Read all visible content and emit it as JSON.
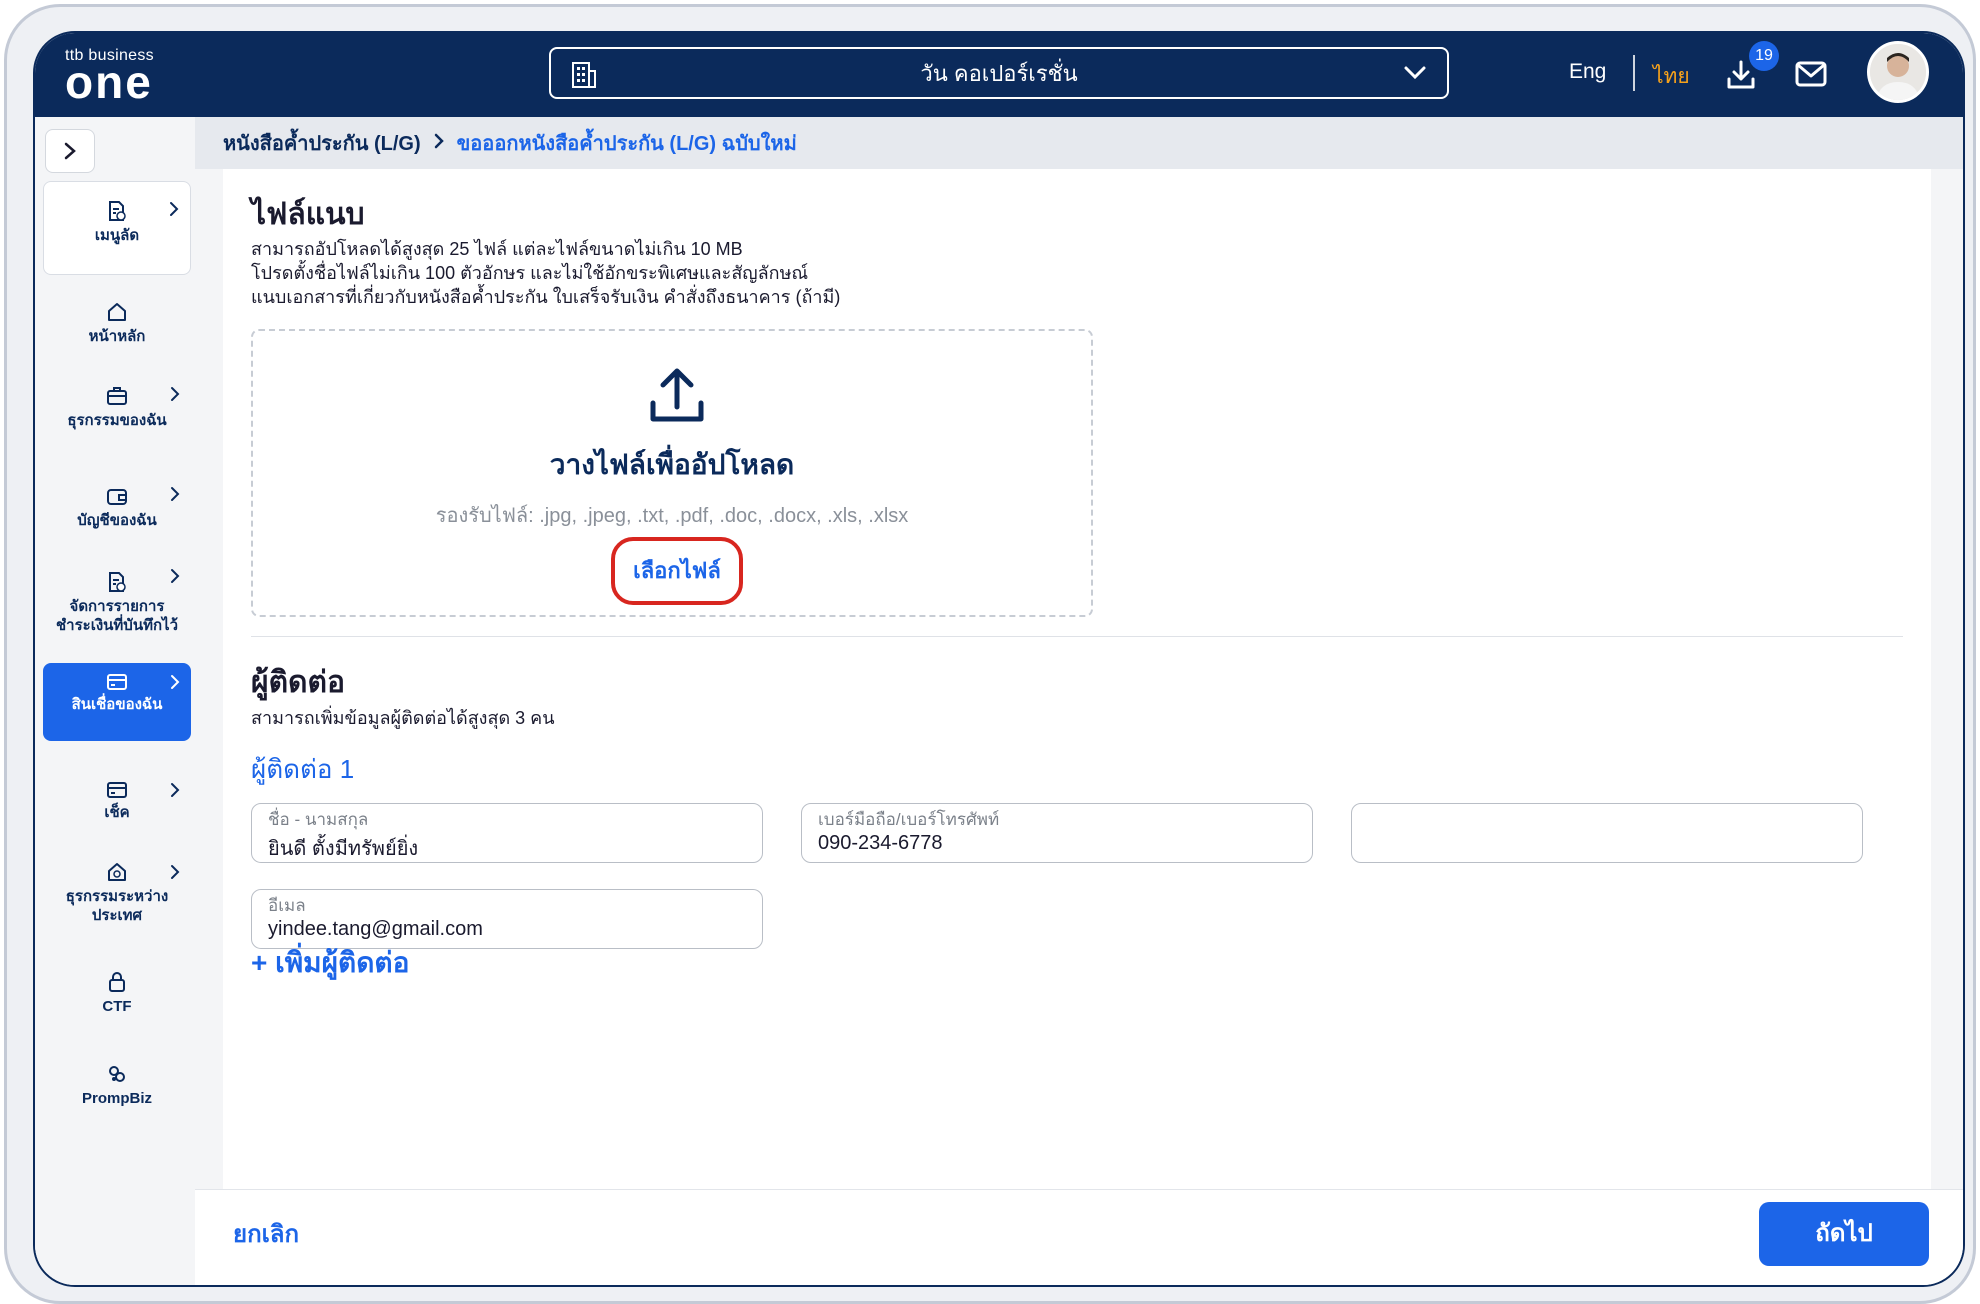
{
  "brand": {
    "small": "ttb business",
    "big": "one"
  },
  "header": {
    "company": "วัน คอเปอร์เรชั่น",
    "lang_eng": "Eng",
    "lang_thai": "ไทย",
    "download_badge": "19"
  },
  "sidebar": {
    "items": [
      {
        "label": "เมนูลัด",
        "icon": "document-star-icon",
        "chevron": true
      },
      {
        "label": "หน้าหลัก",
        "icon": "home-icon",
        "chevron": false
      },
      {
        "label": "ธุรกรรมของฉัน",
        "icon": "briefcase-icon",
        "chevron": true
      },
      {
        "label": "บัญชีของฉัน",
        "icon": "wallet-icon",
        "chevron": true
      },
      {
        "label": "จัดการรายการชำระเงินที่บันทึกไว้",
        "icon": "document-edit-icon",
        "chevron": true
      },
      {
        "label": "สินเชื่อของฉัน",
        "icon": "credit-card-icon",
        "chevron": true
      },
      {
        "label": "เช็ค",
        "icon": "cheque-icon",
        "chevron": true
      },
      {
        "label": "ธุรกรรมระหว่างประเทศ",
        "icon": "international-home-icon",
        "chevron": true
      },
      {
        "label": "CTF",
        "icon": "lock-icon",
        "chevron": false
      },
      {
        "label": "PrompBiz",
        "icon": "prompbiz-icon",
        "chevron": false
      }
    ]
  },
  "breadcrumb": {
    "level1": "หนังสือค้ำประกัน (L/G)",
    "level2": "ขอออกหนังสือค้ำประกัน (L/G) ฉบับใหม่"
  },
  "attachments": {
    "title": "ไฟล์แนบ",
    "desc1": "สามารถอัปโหลดได้สูงสุด 25 ไฟล์ แต่ละไฟล์ขนาดไม่เกิน 10 MB",
    "desc2": "โปรดตั้งชื่อไฟล์ไม่เกิน 100 ตัวอักษร และไม่ใช้อักขระพิเศษและสัญลักษณ์",
    "desc3": "แนบเอกสารที่เกี่ยวกับหนังสือค้ำประกัน ใบเสร็จรับเงิน คำสั่งถึงธนาคาร (ถ้ามี)",
    "drop_title": "วางไฟล์เพื่ออัปโหลด",
    "drop_formats": "รองรับไฟล์: .jpg, .jpeg, .txt, .pdf, .doc, .docx, .xls, .xlsx",
    "choose_file": "เลือกไฟล์"
  },
  "contacts": {
    "title": "ผู้ติดต่อ",
    "desc": "สามารถเพิ่มข้อมูลผู้ติดต่อได้สูงสุด 3 คน",
    "contact_label": "ผู้ติดต่อ 1",
    "name_label": "ชื่อ - นามสกุล",
    "name_value": "ยินดี ตั้งมีทรัพย์ยิ่ง",
    "phone_label": "เบอร์มือถือ/เบอร์โทรศัพท์",
    "phone_value": "090-234-6778",
    "email_label": "อีเมล",
    "email_value": "yindee.tang@gmail.com",
    "add_contact": "+ เพิ่มผู้ติดต่อ"
  },
  "footer": {
    "cancel": "ยกเลิก",
    "next": "ถัดไป"
  },
  "colors": {
    "navy": "#0b2a5b",
    "primary_blue": "#1c65e8",
    "thai_orange": "#f7a21b",
    "highlight_red": "#d8261f"
  }
}
